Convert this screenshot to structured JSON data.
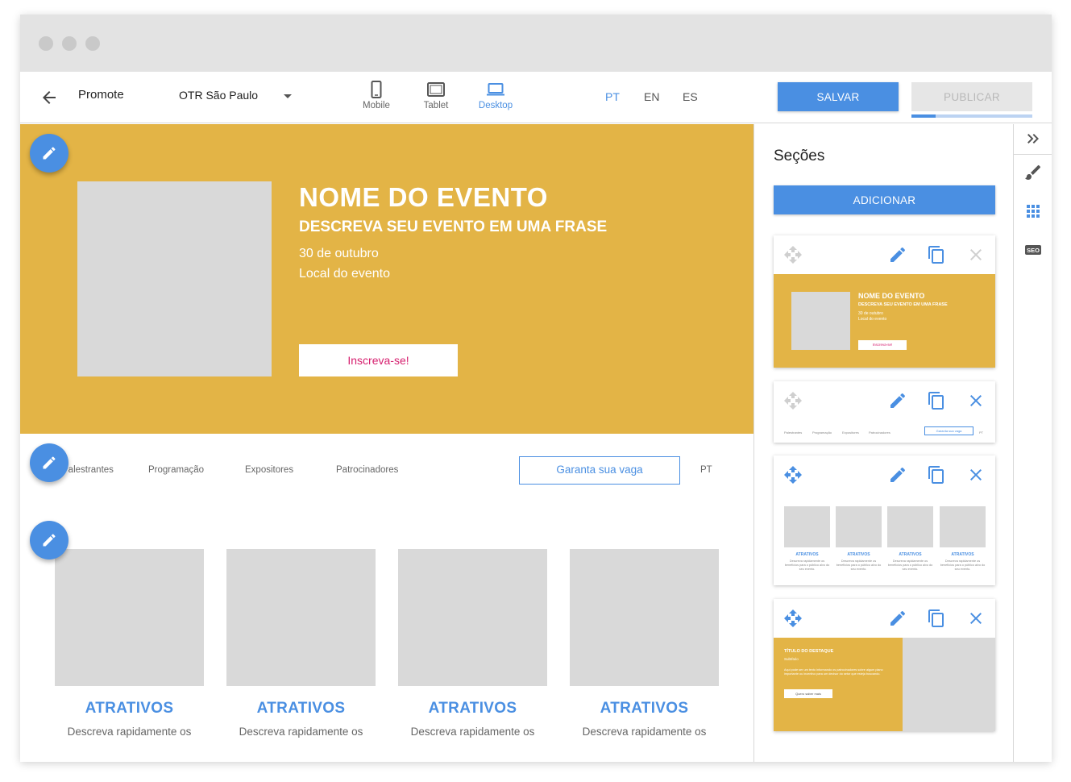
{
  "header": {
    "app_title": "Promote",
    "event_selector": "OTR São Paulo",
    "devices": [
      {
        "label": "Mobile",
        "icon": "mobile-icon",
        "active": false
      },
      {
        "label": "Tablet",
        "icon": "tablet-icon",
        "active": false
      },
      {
        "label": "Desktop",
        "icon": "desktop-icon",
        "active": true
      }
    ],
    "languages": [
      "PT",
      "EN",
      "ES"
    ],
    "active_language": "PT",
    "save_label": "SALVAR",
    "publish_label": "PUBLICAR",
    "publish_progress": 0.2
  },
  "hero": {
    "title": "NOME DO EVENTO",
    "subtitle": "DESCREVA SEU EVENTO EM UMA FRASE",
    "date": "30 de outubro",
    "location": "Local do evento",
    "cta": "Inscreva-se!"
  },
  "nav": {
    "links": [
      "Palestrantes",
      "Programação",
      "Expositores",
      "Patrocinadores"
    ],
    "cta": "Garanta sua vaga",
    "lang": "PT"
  },
  "attractions": [
    {
      "title": "ATRATIVOS",
      "description": "Descreva rapidamente os"
    },
    {
      "title": "ATRATIVOS",
      "description": "Descreva rapidamente os"
    },
    {
      "title": "ATRATIVOS",
      "description": "Descreva rapidamente os"
    },
    {
      "title": "ATRATIVOS",
      "description": "Descreva rapidamente os"
    }
  ],
  "panel": {
    "title": "Seções",
    "add_label": "ADICIONAR",
    "hero_preview": {
      "title": "NOME DO EVENTO",
      "subtitle": "DESCREVA SEU EVENTO EM UMA FRASE",
      "date": "30 de outubro",
      "location": "Local do evento",
      "cta": "Inscreva-se!"
    },
    "nav_preview": {
      "links": [
        "Palestrantes",
        "Programação",
        "Expositores",
        "Patrocinadores"
      ],
      "cta": "Garanta sua vaga",
      "lang": "PT"
    },
    "attr_preview": {
      "title": "ATRATIVOS",
      "description": "Descreva rapidamente os benefícios para o público alvo do seu evento."
    },
    "highlight_preview": {
      "title": "TÍTULO DO DESTAQUE",
      "subtitle": "Subtítulo",
      "text": "Aqui pode ser um texto informando os patrocinadores sobre algum plano importante ou incentivo para um decisor do setor que esteja buscando.",
      "cta": "Quero saber mais"
    }
  },
  "rail": {
    "icons": [
      "collapse-icon",
      "brush-icon",
      "grid-icon",
      "seo-icon"
    ],
    "seo_label": "SEO"
  },
  "colors": {
    "accent": "#4a8fe2",
    "hero_bg": "#e3b446",
    "cta_text": "#d6206f",
    "placeholder": "#d9d9d9"
  }
}
